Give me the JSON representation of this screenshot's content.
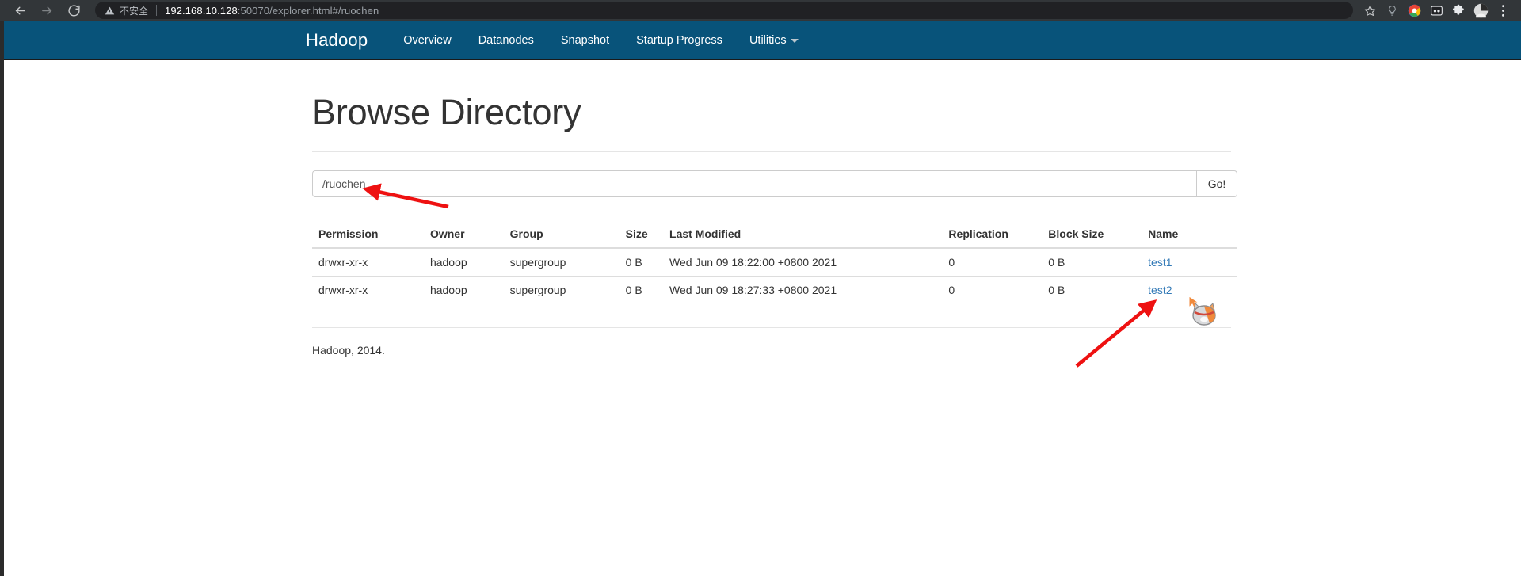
{
  "browser": {
    "back_icon": "arrow-left-icon",
    "forward_icon": "arrow-right-icon",
    "reload_icon": "reload-icon",
    "security_label": "不安全",
    "security_icon": "warning-triangle-icon",
    "url_host": "192.168.10.128",
    "url_rest": ":50070/explorer.html#/ruochen",
    "url_full": "192.168.10.128:50070/explorer.html#/ruochen",
    "toolbar_icons": [
      "bookmark-star-icon",
      "lightbulb-icon",
      "google-colored-icon",
      "robot-extension-icon",
      "puzzle-extensions-icon",
      "profile-avatar-icon",
      "chrome-menu-icon"
    ]
  },
  "navbar": {
    "brand": "Hadoop",
    "brand_color": "#ffffff",
    "background_color": "#08537a",
    "items": [
      {
        "label": "Overview",
        "has_caret": false
      },
      {
        "label": "Datanodes",
        "has_caret": false
      },
      {
        "label": "Snapshot",
        "has_caret": false
      },
      {
        "label": "Startup Progress",
        "has_caret": false
      },
      {
        "label": "Utilities",
        "has_caret": true
      }
    ]
  },
  "main": {
    "title": "Browse Directory",
    "path_input": {
      "value": "/ruochen",
      "placeholder": "/"
    },
    "go_button": "Go!",
    "table": {
      "headers": [
        "Permission",
        "Owner",
        "Group",
        "Size",
        "Last Modified",
        "Replication",
        "Block Size",
        "Name"
      ],
      "rows": [
        {
          "permission": "drwxr-xr-x",
          "owner": "hadoop",
          "group": "supergroup",
          "size": "0 B",
          "last_modified": "Wed Jun 09 18:22:00 +0800 2021",
          "replication": "0",
          "block_size": "0 B",
          "name": "test1"
        },
        {
          "permission": "drwxr-xr-x",
          "owner": "hadoop",
          "group": "supergroup",
          "size": "0 B",
          "last_modified": "Wed Jun 09 18:27:33 +0800 2021",
          "replication": "0",
          "block_size": "0 B",
          "name": "test2"
        }
      ]
    }
  },
  "footer": {
    "text": "Hadoop, 2014."
  },
  "annotations": {
    "arrow_color": "#ee1111",
    "arrow_to_path_input": "red arrow pointing left at the /ruochen path input",
    "arrow_to_test2": "red arrow pointing up-right at the test2 link",
    "cursor": "cat-head-cursor-icon"
  }
}
